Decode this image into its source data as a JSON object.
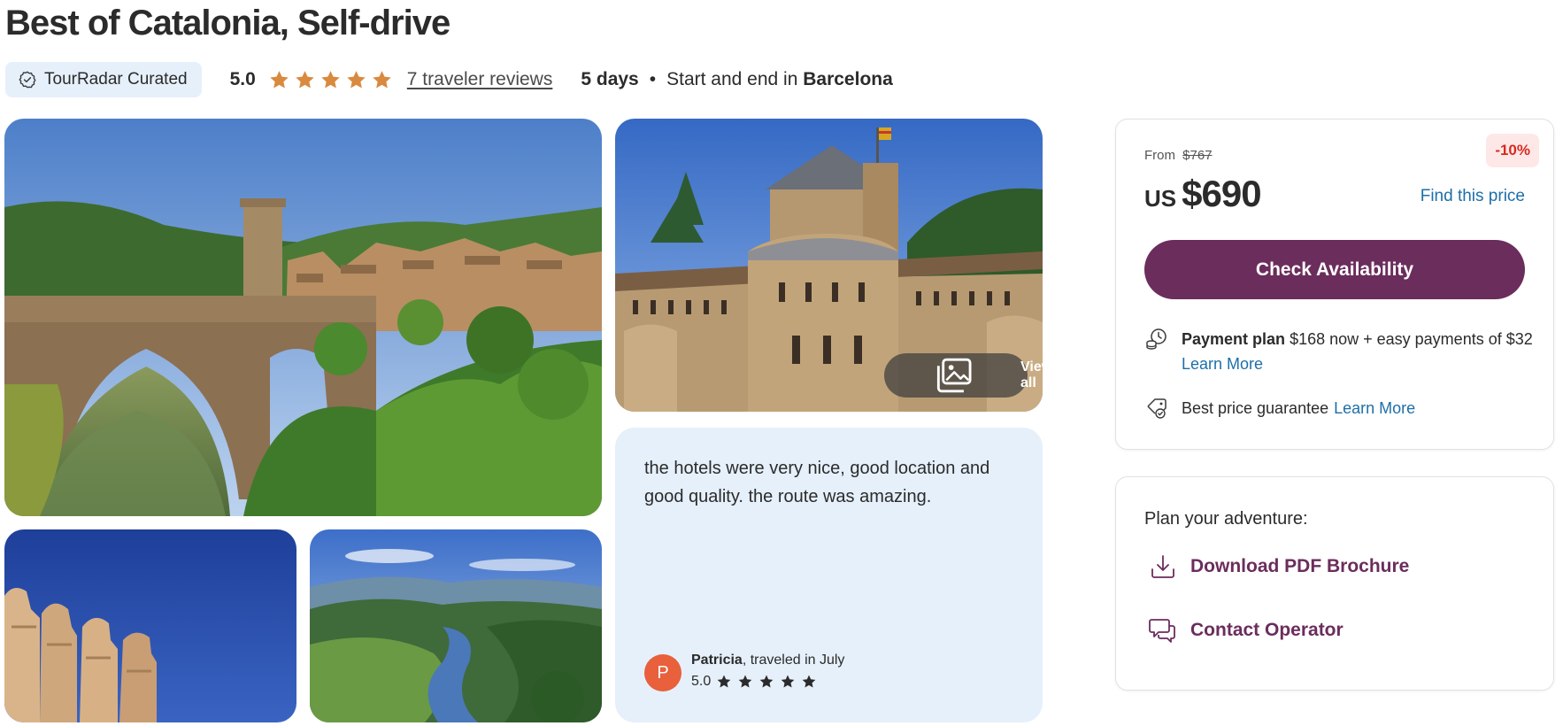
{
  "header": {
    "title": "Best of Catalonia, Self-drive",
    "badge": "TourRadar Curated",
    "rating": "5.0",
    "stars": 5,
    "reviews_link": "7 traveler reviews",
    "duration": "5 days",
    "separator": "•",
    "start_end_prefix": "Start and end in",
    "start_end_city": "Barcelona"
  },
  "gallery": {
    "view_all_label": "View all"
  },
  "review": {
    "text": "the hotels were very nice, good location and good quality. the route was amazing.",
    "avatar_initial": "P",
    "reviewer_name": "Patricia",
    "traveled": ", traveled in July",
    "rating": "5.0",
    "stars": 5
  },
  "pricing": {
    "from_label": "From",
    "old_price": "$767",
    "discount": "-10%",
    "currency": "US",
    "price": "$690",
    "find_price_label": "Find this price",
    "check_availability_label": "Check Availability",
    "payment_plan_label": "Payment plan",
    "payment_plan_text": "$168 now + easy payments of $32",
    "learn_more_label": "Learn More",
    "guarantee_text": "Best price guarantee",
    "guarantee_link": "Learn More"
  },
  "plan": {
    "title": "Plan your adventure:",
    "download_label": "Download PDF Brochure",
    "contact_label": "Contact Operator"
  },
  "colors": {
    "accent_purple": "#6b2d5c",
    "star_orange": "#d98a3f",
    "link_blue": "#1e6fa8",
    "discount_red": "#d62b1f",
    "badge_bg": "#e6f0fb",
    "avatar_bg": "#e8603c"
  }
}
